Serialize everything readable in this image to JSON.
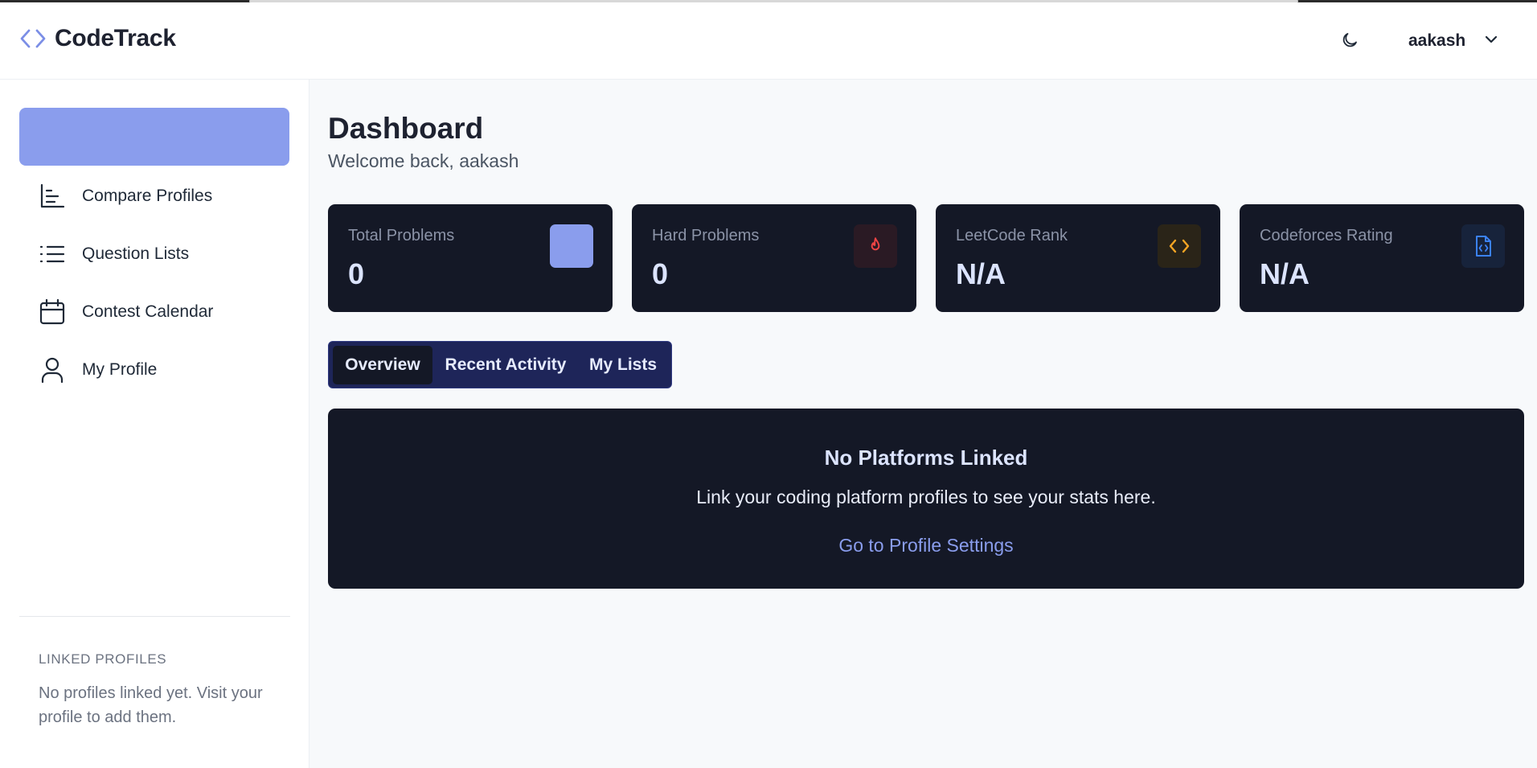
{
  "app": {
    "name": "CodeTrack"
  },
  "header": {
    "user_name": "aakash"
  },
  "sidebar": {
    "items": [
      {
        "label": "Compare Profiles"
      },
      {
        "label": "Question Lists"
      },
      {
        "label": "Contest Calendar"
      },
      {
        "label": "My Profile"
      }
    ],
    "linked_title": "LINKED PROFILES",
    "linked_text": "No profiles linked yet. Visit your profile to add them."
  },
  "page": {
    "title": "Dashboard",
    "subtitle": "Welcome back, aakash"
  },
  "stats": [
    {
      "label": "Total Problems",
      "value": "0",
      "icon": "square-icon",
      "icon_bg": "#8a9ded"
    },
    {
      "label": "Hard Problems",
      "value": "0",
      "icon": "flame-icon",
      "icon_bg": "#2a1a24",
      "icon_color": "#ef4444"
    },
    {
      "label": "LeetCode Rank",
      "value": "N/A",
      "icon": "code-icon",
      "icon_bg": "#2a2418",
      "icon_color": "#f5a524"
    },
    {
      "label": "Codeforces Rating",
      "value": "N/A",
      "icon": "code-file-icon",
      "icon_bg": "#17233b",
      "icon_color": "#3b82f6"
    }
  ],
  "tabs": [
    {
      "label": "Overview"
    },
    {
      "label": "Recent Activity"
    },
    {
      "label": "My Lists"
    }
  ],
  "empty_state": {
    "title": "No Platforms Linked",
    "text": "Link your coding platform profiles to see your stats here.",
    "link": "Go to Profile Settings"
  },
  "colors": {
    "accent": "#8a9ded",
    "card_bg": "#141826",
    "tabs_bg": "#1e2559"
  }
}
